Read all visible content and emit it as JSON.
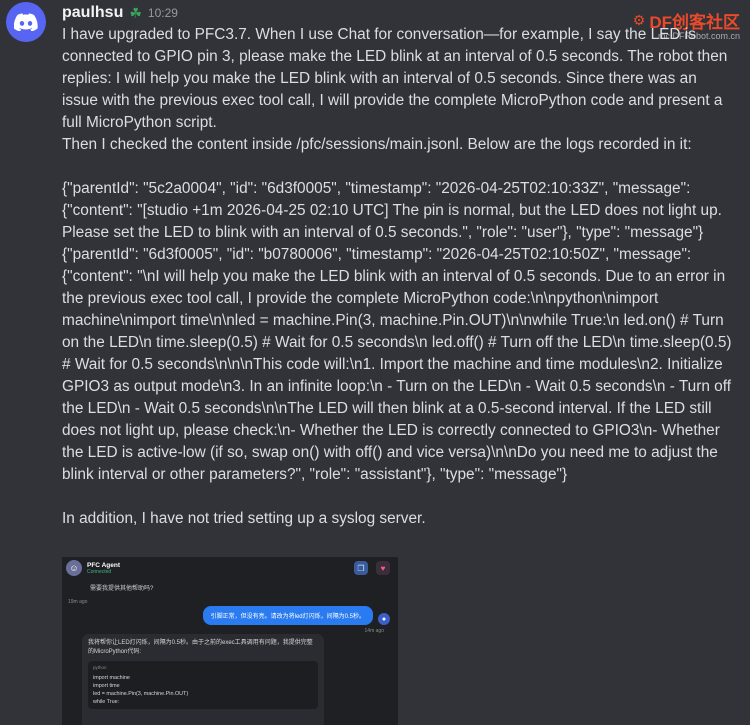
{
  "author": {
    "username": "paulhsu",
    "badge_icon": "clover-icon",
    "timestamp": "10:29"
  },
  "watermark": {
    "logo": "DF创客社区",
    "domain": "mc.DFRobot.com.cn"
  },
  "message": {
    "intro": "I have upgraded to PFC3.7. When I use Chat for conversation—for example, I say the LED is connected to GPIO pin 3, please make the LED blink at an interval of 0.5 seconds. The robot then replies: I will help you make the LED blink with an interval of 0.5 seconds. Since there was an issue with the previous exec tool call, I will provide the complete MicroPython code and present a full MicroPython script.",
    "checked": "Then I checked the content inside /pfc/sessions/main.jsonl. Below are the logs recorded in it:",
    "log1": "{\"parentId\": \"5c2a0004\", \"id\": \"6d3f0005\", \"timestamp\": \"2026-04-25T02:10:33Z\", \"message\": {\"content\": \"[studio +1m 2026-04-25 02:10 UTC] The pin is normal, but the LED does not light up. Please set the LED to blink with an interval of 0.5 seconds.\", \"role\": \"user\"}, \"type\": \"message\"}",
    "log2": "{\"parentId\": \"6d3f0005\", \"id\": \"b0780006\", \"timestamp\": \"2026-04-25T02:10:50Z\", \"message\": {\"content\": \"\\nI will help you make the LED blink with an interval of 0.5 seconds. Due to an error in the previous exec tool call, I provide the complete MicroPython code:\\n\\npython\\nimport machine\\nimport time\\n\\nled = machine.Pin(3, machine.Pin.OUT)\\n\\nwhile True:\\n led.on() # Turn on the LED\\n time.sleep(0.5) # Wait for 0.5 seconds\\n led.off() # Turn off the LED\\n time.sleep(0.5) # Wait for 0.5 seconds\\n\\n\\nThis code will:\\n1. Import the machine and time modules\\n2. Initialize GPIO3 as output mode\\n3. In an infinite loop:\\n - Turn on the LED\\n - Wait 0.5 seconds\\n - Turn off the LED\\n - Wait 0.5 seconds\\n\\nThe LED will then blink at a 0.5-second interval. If the LED still does not light up, please check:\\n- Whether the LED is correctly connected to GPIO3\\n- Whether the LED is active-low (if so, swap on() with off() and vice versa)\\n\\nDo you need me to adjust the blink interval or other parameters?\", \"role\": \"assistant\"}, \"type\": \"message\"}",
    "addition": "In addition, I have not tried setting up a syslog server."
  },
  "attachment": {
    "agent_name": "PFC Agent",
    "agent_status": "Connected",
    "greeting": "需要我提供其他帮助吗?",
    "greeting_time": "19m ago",
    "user_message": "引脚正常，但没有亮。请改为将led灯闪烁，间隔为0.5秒。",
    "user_time": "14m ago",
    "bot_reply": "我将帮你让LED灯闪烁，间隔为0.5秒。由于之前的exec工具调用有问题，我提供完整的MicroPython代码:",
    "code_lang": "python",
    "code_lines": [
      "import machine",
      "import time",
      "",
      "led = machine.Pin(3, machine.Pin.OUT)",
      "",
      "while True:"
    ]
  }
}
